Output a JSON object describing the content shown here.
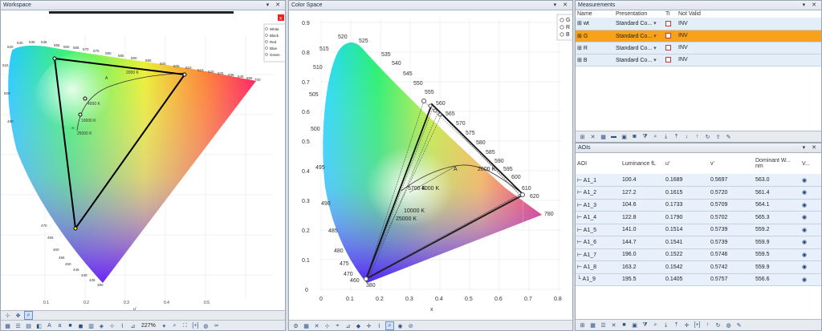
{
  "workspace": {
    "title": "Workspace",
    "title_controls": "▾ ✕",
    "legend": [
      "White",
      "Black",
      "Red",
      "Blue",
      "Green"
    ],
    "top_labels": [
      "520",
      "525",
      "530",
      "535",
      "540",
      "545",
      "550",
      "555",
      "560",
      "565",
      "570",
      "575",
      "580",
      "585",
      "590",
      "595",
      "600",
      "605",
      "610",
      "615",
      "620",
      "625",
      "630",
      "635",
      "640",
      "645",
      "650",
      "655",
      "660",
      "665",
      "670",
      "675",
      "680",
      "685",
      "690",
      "695",
      "700"
    ],
    "left_labels": [
      "515",
      "510",
      "505",
      "500",
      "495",
      "490",
      "485",
      "480",
      "475",
      "470",
      "465",
      "460",
      "455",
      "450",
      "445",
      "440",
      "435",
      "430",
      "425",
      "420",
      "415",
      "410",
      "405",
      "400",
      "395",
      "390",
      "385",
      "380"
    ],
    "x_ticks": [
      "0.1",
      "0.2",
      "0.3",
      "0.4",
      "0.5"
    ],
    "x_axis_label": "u'",
    "locus_labels": [
      "A",
      "2000 K",
      "4000 K",
      "10000 K",
      "25000 K",
      "∞"
    ],
    "zoom": "227%"
  },
  "colorspace": {
    "title": "Color Space",
    "legend": [
      "G",
      "R",
      "B"
    ],
    "x_ticks": [
      "0",
      "0.1",
      "0.2",
      "0.3",
      "0.4",
      "0.5",
      "0.6",
      "0.7",
      "0.8"
    ],
    "y_ticks": [
      "0",
      "0.1",
      "0.2",
      "0.3",
      "0.4",
      "0.5",
      "0.6",
      "0.7",
      "0.8",
      "0.9"
    ],
    "x_axis_label": "x",
    "wavelengths": [
      "380",
      "460",
      "470",
      "475",
      "480",
      "485",
      "490",
      "495",
      "500",
      "505",
      "510",
      "515",
      "520",
      "525",
      "535",
      "540",
      "545",
      "550",
      "555",
      "560",
      "565",
      "570",
      "575",
      "580",
      "585",
      "590",
      "595",
      "600",
      "610",
      "620",
      "780"
    ],
    "locus_labels": [
      "A",
      "2000 K",
      "4000 K",
      "5700 K",
      "10000 K",
      "25000 K"
    ]
  },
  "measurements": {
    "title": "Measurements",
    "columns": [
      "Name",
      "Presentation",
      "Ti",
      "Not Valid"
    ],
    "rows": [
      {
        "name": "wt",
        "presentation": "Standard Co...",
        "not_valid": "INV"
      },
      {
        "name": "G",
        "presentation": "Standard Co...",
        "not_valid": "INV"
      },
      {
        "name": "R",
        "presentation": "Standard Co...",
        "not_valid": "INV"
      },
      {
        "name": "B",
        "presentation": "Standard Co...",
        "not_valid": "INV"
      }
    ],
    "selected_row": 1
  },
  "aois": {
    "title": "AOIs",
    "columns": [
      "AOI",
      "Luminance fL",
      "u'",
      "v'",
      "Dominant W... nm",
      "V..."
    ],
    "rows": [
      [
        "A1_1",
        "100.4",
        "0.1689",
        "0.5697",
        "563.0"
      ],
      [
        "A1_2",
        "127.2",
        "0.1615",
        "0.5720",
        "561.4"
      ],
      [
        "A1_3",
        "104.6",
        "0.1733",
        "0.5709",
        "564.1"
      ],
      [
        "A1_4",
        "122.8",
        "0.1790",
        "0.5702",
        "565.3"
      ],
      [
        "A1_5",
        "141.0",
        "0.1514",
        "0.5739",
        "559.2"
      ],
      [
        "A1_6",
        "144.7",
        "0.1541",
        "0.5739",
        "559.9"
      ],
      [
        "A1_7",
        "196.0",
        "0.1522",
        "0.5746",
        "559.5"
      ],
      [
        "A1_8",
        "163.2",
        "0.1542",
        "0.5742",
        "559.9"
      ],
      [
        "A1_9",
        "195.5",
        "0.1405",
        "0.5757",
        "556.6"
      ]
    ]
  }
}
